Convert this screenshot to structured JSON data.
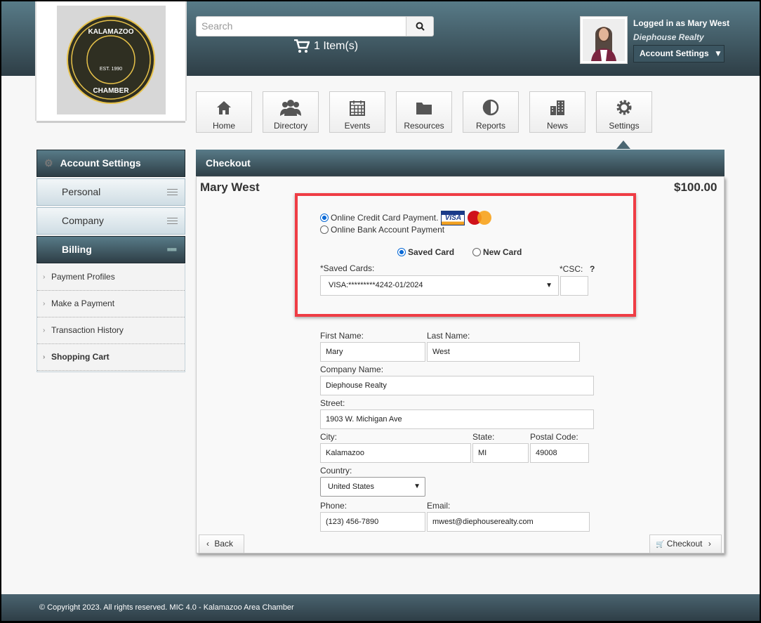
{
  "header": {
    "logo_text": "KALAMAZOO CHAMBER EST. 1990",
    "search_placeholder": "Search",
    "cart_label": "1 Item(s)",
    "logged_in": "Logged in as Mary West",
    "company": "Diephouse Realty",
    "account_button": "Account Settings"
  },
  "nav": [
    {
      "label": "Home",
      "icon": "home-icon"
    },
    {
      "label": "Directory",
      "icon": "users-icon"
    },
    {
      "label": "Events",
      "icon": "calendar-icon"
    },
    {
      "label": "Resources",
      "icon": "folder-icon"
    },
    {
      "label": "Reports",
      "icon": "pie-icon"
    },
    {
      "label": "News",
      "icon": "building-icon"
    },
    {
      "label": "Settings",
      "icon": "gear-icon"
    }
  ],
  "sidebar": {
    "title": "Account Settings",
    "sections": [
      "Personal",
      "Company",
      "Billing"
    ],
    "billing_items": [
      "Payment Profiles",
      "Make a Payment",
      "Transaction History",
      "Shopping Cart"
    ]
  },
  "checkout": {
    "title": "Checkout",
    "name": "Mary West",
    "total": "$100.00",
    "payment_options": [
      "Online Credit Card Payment.",
      "Online Bank Account Payment"
    ],
    "card_options": [
      "Saved Card",
      "New Card"
    ],
    "saved_cards_label": "*Saved Cards:",
    "saved_card_value": "VISA:*********4242-01/2024",
    "csc_label": "*CSC:",
    "csc_help": "?",
    "visa_text": "VISA",
    "mc_text": "MasterCard",
    "form": {
      "first_name_label": "First Name:",
      "first_name": "Mary",
      "last_name_label": "Last Name:",
      "last_name": "West",
      "company_label": "Company Name:",
      "company": "Diephouse Realty",
      "street_label": "Street:",
      "street": "1903 W. Michigan Ave",
      "city_label": "City:",
      "city": "Kalamazoo",
      "state_label": "State:",
      "state": "MI",
      "postal_label": "Postal Code:",
      "postal": "49008",
      "country_label": "Country:",
      "country": "United States",
      "phone_label": "Phone:",
      "phone": "(123) 456-7890",
      "email_label": "Email:",
      "email": "mwest@diephouserealty.com"
    },
    "back_button": "Back",
    "checkout_button": "Checkout"
  },
  "footer": {
    "text": "© Copyright 2023. All rights reserved. MIC 4.0 - Kalamazoo Area Chamber"
  },
  "colors": {
    "header": "#3e5864",
    "highlight": "#ef3d45",
    "radio": "#0a6ad6"
  }
}
